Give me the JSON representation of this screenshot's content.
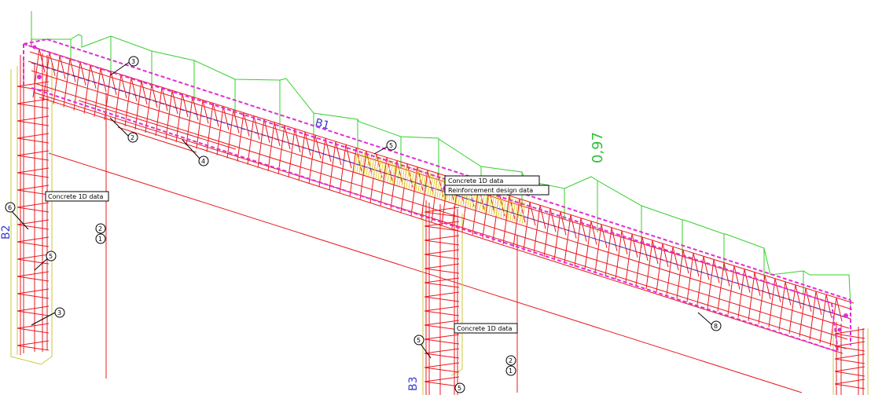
{
  "colors": {
    "rebar": "#e8181f",
    "stirrup": "#e8181f",
    "outline": "#e22cd6",
    "diagram": "#34d02a",
    "column_outline": "#c9c93a",
    "member_label": "#3b3bd0",
    "value_label": "#2fbf3a",
    "dense_zone": "#e2d13a"
  },
  "labels": {
    "beam_b1": "B1",
    "column_b2": "B2",
    "column_b3": "B3",
    "diagram_value": "0,97"
  },
  "tags": {
    "concrete_1d_left": "Concrete 1D data",
    "concrete_1d_mid": "Concrete 1D data",
    "reinforcement_design": "Reinforcement design data",
    "concrete_1d_lower": "Concrete 1D data"
  },
  "bar_marks": {
    "m1": "3",
    "m2": "2",
    "m3": "4",
    "m4": "5",
    "m5": "8",
    "m6": "6",
    "m7": "5",
    "m8": "3",
    "m9": "5",
    "m10": "5",
    "m11": "1",
    "m12": "2",
    "m13": "1",
    "m14": "2"
  }
}
